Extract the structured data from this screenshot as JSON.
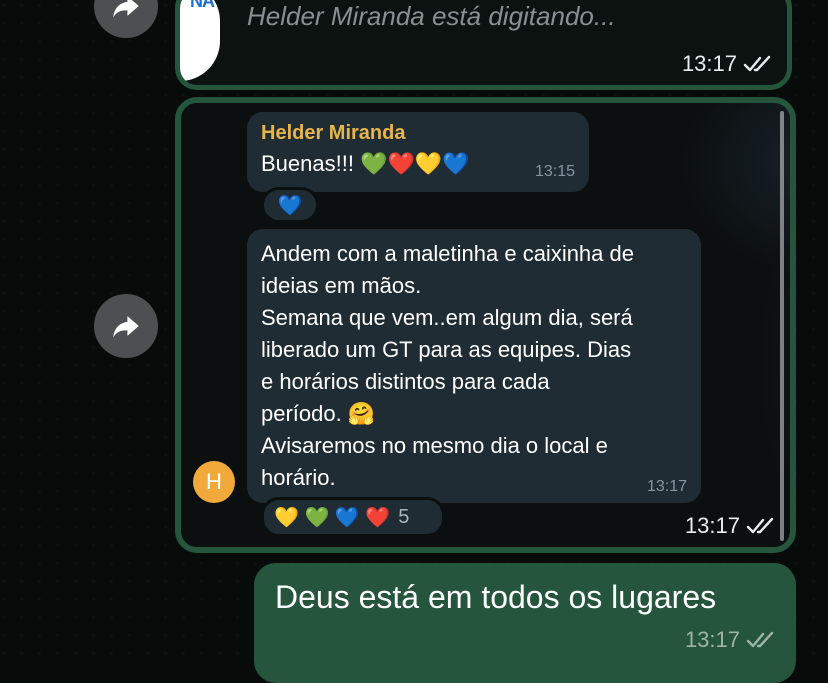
{
  "story_top": {
    "thumb_text": "NA",
    "typing_text": "Helder Miranda está digitando...",
    "time": "13:17"
  },
  "story_main": {
    "first_message": {
      "sender": "Helder Miranda",
      "text": "Buenas!!! 💚❤️💛💙",
      "time": "13:15",
      "reaction": "💙"
    },
    "second_message": {
      "lines": [
        "Andem com a maletinha e caixinha de",
        "ideias em mãos.",
        "Semana que vem..em algum dia, será",
        "liberado um GT para as equipes. Dias",
        "e horários distintos para cada",
        "período. 🤗",
        "Avisaremos no mesmo dia o local e",
        "horário."
      ],
      "time": "13:17",
      "reactions": "💛 💚 💙 ❤️",
      "reaction_count": "5",
      "avatar_letter": "H"
    },
    "time": "13:17"
  },
  "outgoing": {
    "text": "Deus está em todos os lugares",
    "time": "13:17"
  },
  "colors": {
    "outgoing_green": "#25553c",
    "incoming_bubble": "#202c33",
    "sender_name": "#e8b54a",
    "avatar": "#f2a93b"
  },
  "icons": [
    "forward-icon",
    "double-check-icon"
  ]
}
